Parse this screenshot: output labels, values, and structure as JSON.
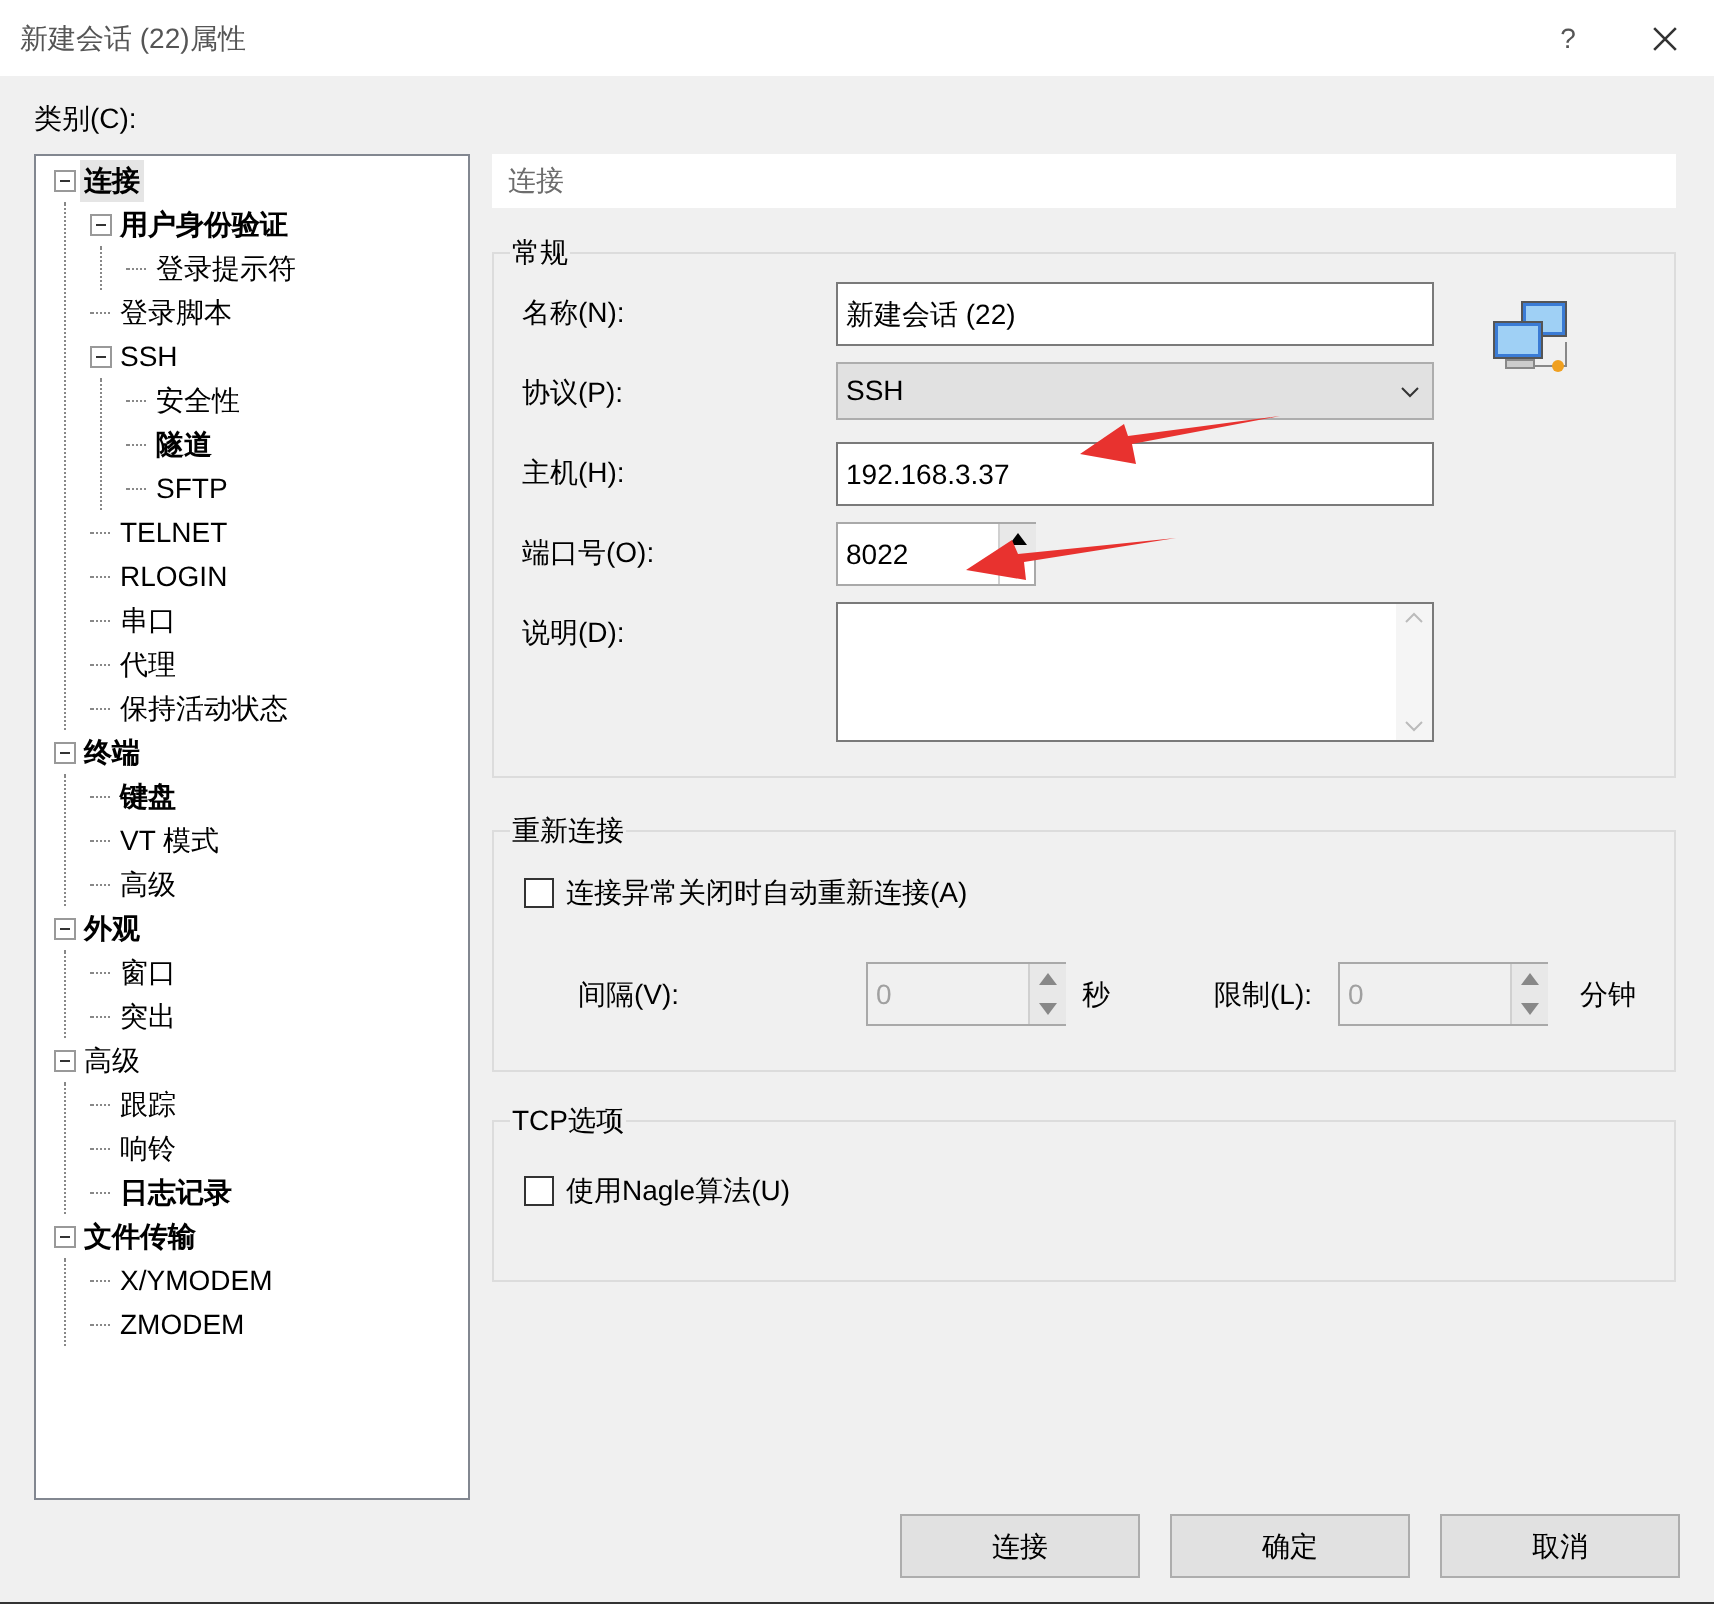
{
  "window": {
    "title": "新建会话 (22)属性",
    "help": "?"
  },
  "category_label": "类别(C):",
  "tree": [
    {
      "label": "连接",
      "bold": true,
      "selected": true,
      "expanded": true,
      "children": [
        {
          "label": "用户身份验证",
          "bold": true,
          "selected": false,
          "expanded": true,
          "children": [
            {
              "label": "登录提示符",
              "bold": false,
              "selected": false
            }
          ]
        },
        {
          "label": "登录脚本",
          "bold": false,
          "selected": false
        },
        {
          "label": "SSH",
          "bold": false,
          "selected": false,
          "expanded": true,
          "children": [
            {
              "label": "安全性",
              "bold": false,
              "selected": false
            },
            {
              "label": "隧道",
              "bold": true,
              "selected": false
            },
            {
              "label": "SFTP",
              "bold": false,
              "selected": false
            }
          ]
        },
        {
          "label": "TELNET",
          "bold": false,
          "selected": false
        },
        {
          "label": "RLOGIN",
          "bold": false,
          "selected": false
        },
        {
          "label": "串口",
          "bold": false,
          "selected": false
        },
        {
          "label": "代理",
          "bold": false,
          "selected": false
        },
        {
          "label": "保持活动状态",
          "bold": false,
          "selected": false
        }
      ]
    },
    {
      "label": "终端",
      "bold": true,
      "selected": false,
      "expanded": true,
      "children": [
        {
          "label": "键盘",
          "bold": true,
          "selected": false
        },
        {
          "label": "VT 模式",
          "bold": false,
          "selected": false
        },
        {
          "label": "高级",
          "bold": false,
          "selected": false
        }
      ]
    },
    {
      "label": "外观",
      "bold": true,
      "selected": false,
      "expanded": true,
      "children": [
        {
          "label": "窗口",
          "bold": false,
          "selected": false
        },
        {
          "label": "突出",
          "bold": false,
          "selected": false
        }
      ]
    },
    {
      "label": "高级",
      "bold": false,
      "selected": false,
      "expanded": true,
      "children": [
        {
          "label": "跟踪",
          "bold": false,
          "selected": false
        },
        {
          "label": "响铃",
          "bold": false,
          "selected": false
        },
        {
          "label": "日志记录",
          "bold": true,
          "selected": false
        }
      ]
    },
    {
      "label": "文件传输",
      "bold": true,
      "selected": false,
      "expanded": true,
      "children": [
        {
          "label": "X/YMODEM",
          "bold": false,
          "selected": false
        },
        {
          "label": "ZMODEM",
          "bold": false,
          "selected": false
        }
      ]
    }
  ],
  "header": "连接",
  "general": {
    "title": "常规",
    "fields": [
      {
        "kind": "text",
        "label": "名称(N):",
        "value": "新建会话 (22)"
      },
      {
        "kind": "select",
        "label": "协议(P):",
        "value": "SSH"
      },
      {
        "kind": "text",
        "label": "主机(H):",
        "value": "192.168.3.37"
      },
      {
        "kind": "spin",
        "label": "端口号(O):",
        "value": "8022"
      },
      {
        "kind": "textarea",
        "label": "说明(D):"
      }
    ]
  },
  "reconnect": {
    "title": "重新连接",
    "checkbox": {
      "label": "连接异常关闭时自动重新连接(A)",
      "checked": false
    },
    "spins": [
      {
        "label": "间隔(V):",
        "value": "0",
        "unit": "秒",
        "disabled": true
      },
      {
        "label": "限制(L):",
        "value": "0",
        "unit": "分钟",
        "disabled": true
      }
    ]
  },
  "tcp": {
    "title": "TCP选项",
    "checkbox": {
      "label": "使用Nagle算法(U)",
      "checked": false
    }
  },
  "buttons": [
    "连接",
    "确定",
    "取消"
  ]
}
